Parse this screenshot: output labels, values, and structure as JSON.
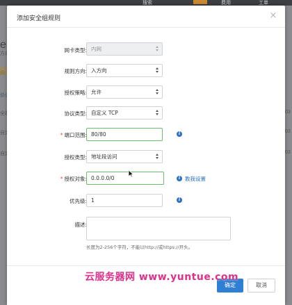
{
  "background": {
    "nav": {
      "search": "搜索",
      "fee": "费用",
      "order": "工单"
    },
    "title_fragment": "eky",
    "labels": [
      "方向",
      "向",
      "协议",
      "全部",
      "自定",
      "自定"
    ],
    "right_fragments": [
      "03",
      "03",
      "03"
    ],
    "close_glyph": "×"
  },
  "modal": {
    "title": "添加安全组规则",
    "close_glyph": "×",
    "fields": {
      "nic_type": {
        "label": "网卡类型:",
        "value": "内网",
        "disabled": true
      },
      "direction": {
        "label": "规则方向:",
        "value": "入方向"
      },
      "policy": {
        "label": "授权策略:",
        "value": "允许"
      },
      "protocol": {
        "label": "协议类型:",
        "value": "自定义 TCP"
      },
      "port_range": {
        "label": "端口范围:",
        "required_mark": "*",
        "value": "80/80"
      },
      "auth_type": {
        "label": "授权类型:",
        "value": "地址段访问"
      },
      "auth_object": {
        "label": "授权对象:",
        "required_mark": "*",
        "value": "0.0.0.0/0",
        "help_link": "教我设置"
      },
      "priority": {
        "label": "优先级:",
        "value": "1"
      },
      "description": {
        "label": "描述:",
        "value": "",
        "hint": "长度为2-256个字符，不能以http://或https://开头。"
      }
    },
    "buttons": {
      "ok": "确定",
      "cancel": "取消"
    }
  },
  "watermark": "云服务器网 www.yuntue.com",
  "colors": {
    "primary": "#2f7fd4",
    "link": "#2f6fc4",
    "active_border": "#6bbd6b",
    "required": "#e44444",
    "watermark": "#e0308a"
  },
  "icons": {
    "info": "info-icon",
    "close": "close-icon",
    "select": "chevron-updown-icon",
    "cursor": "mouse-pointer-icon"
  }
}
